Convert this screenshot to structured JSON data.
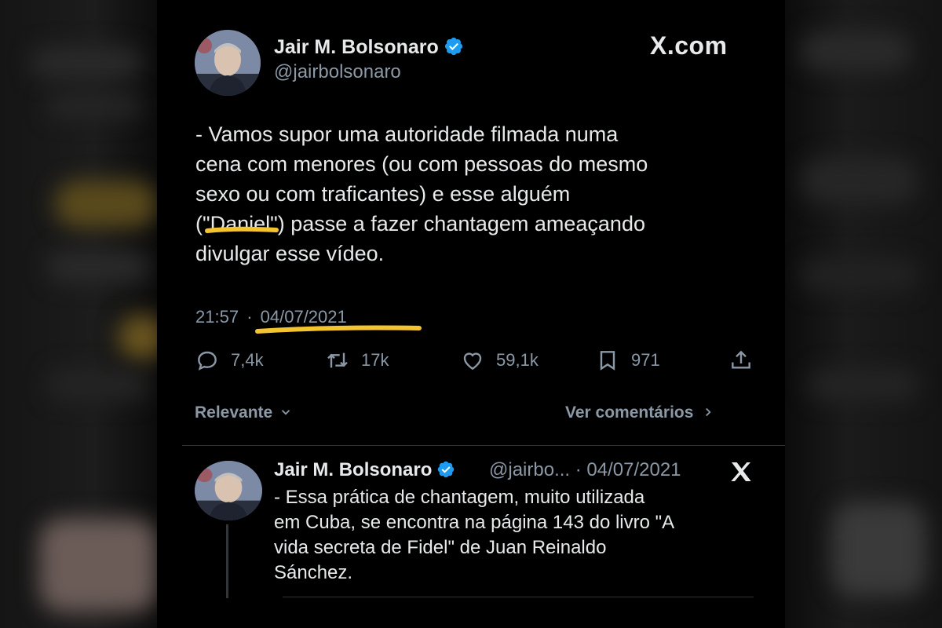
{
  "post": {
    "author_name": "Jair M. Bolsonaro",
    "author_handle": "@jairbolsonaro",
    "site_label": "X.com",
    "text_lines": [
      "- Vamos supor uma autoridade filmada numa",
      "cena com menores (ou com pessoas do mesmo",
      "sexo ou com traficantes) e esse alguém",
      "(\"Daniel\") passe a fazer chantagem ameaçando",
      "divulgar esse vídeo."
    ],
    "time": "21:57",
    "separator": "·",
    "date": "04/07/2021",
    "highlight_color": "#f4c430"
  },
  "stats": {
    "replies": "7,4k",
    "reposts": "17k",
    "likes": "59,1k",
    "bookmarks": "971"
  },
  "sort": {
    "relevance_label": "Relevante",
    "view_comments_label": "Ver comentários"
  },
  "reply": {
    "author_name": "Jair M. Bolsonaro",
    "handle_date": "@jairbo... · 04/07/2021",
    "text_lines": [
      "- Essa prática de chantagem, muito utilizada",
      "em Cuba, se encontra na página 143 do livro \"A",
      "vida secreta de Fidel\" de Juan Reinaldo",
      "Sánchez."
    ]
  },
  "icons": [
    "verified-badge-icon",
    "reply-icon",
    "repost-icon",
    "like-icon",
    "bookmark-icon",
    "share-icon",
    "chevron-down-icon",
    "chevron-right-icon",
    "x-logo-icon"
  ],
  "colors": {
    "background": "#000000",
    "text": "#e7e9ea",
    "muted": "#8b98a5",
    "verified": "#1d9bf0"
  }
}
